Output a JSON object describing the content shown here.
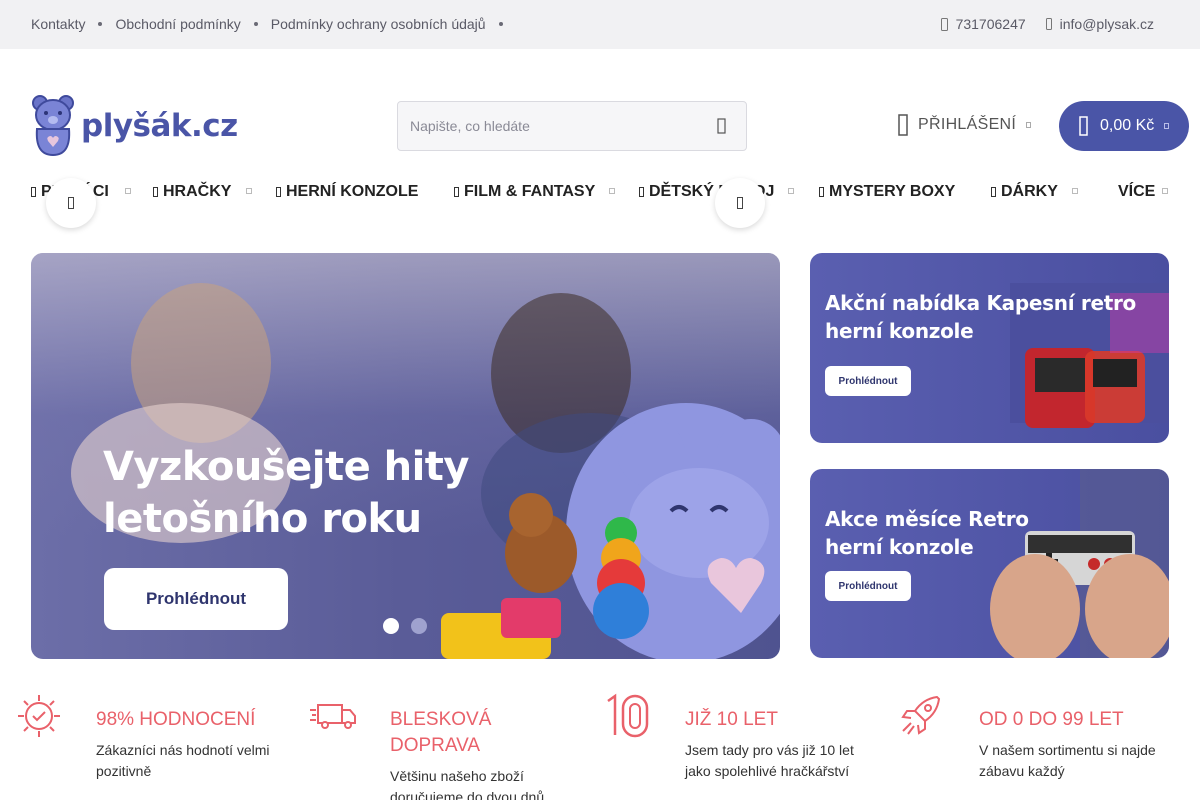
{
  "topbar": {
    "links": [
      "Kontakty",
      "Obchodní podmínky",
      "Podmínky ochrany osobních údajů"
    ],
    "phone": "731706247",
    "email": "info@plysak.cz"
  },
  "header": {
    "logo_text": "plyšák.cz",
    "search_placeholder": "Napište, co hledáte",
    "login_label": "PŘIHLÁŠENÍ",
    "cart_amount": "0,00 Kč"
  },
  "nav": {
    "items": [
      "PLYŠÁCI",
      "HRAČKY",
      "HERNÍ KONZOLE",
      "FILM & FANTASY",
      "DĚTSKÝ POKOJ",
      "MYSTERY BOXY",
      "DÁRKY",
      "VÍCE"
    ]
  },
  "hero": {
    "headline": "Vyzkoušejte hity letošního roku",
    "cta": "Prohlédnout",
    "slides_total": 2,
    "active_slide": 1
  },
  "banners": [
    {
      "title": "Akční nabídka Kapesní retro herní konzole",
      "cta": "Prohlédnout"
    },
    {
      "title": "Akce měsíce Retro herní konzole",
      "cta": "Prohlédnout"
    }
  ],
  "features": [
    {
      "title": "98% HODNOCENÍ",
      "text": "Zákazníci nás hodnotí velmi pozitivně",
      "icon": "rating-badge-icon"
    },
    {
      "title": "BLESKOVÁ DOPRAVA",
      "text": "Většinu našeho zboží doručujeme do dvou dnů",
      "icon": "delivery-truck-icon"
    },
    {
      "title": "JIŽ 10 LET",
      "text": "Jsem tady pro vás již 10 let jako spolehlivé hračkářství",
      "icon": "ten-years-icon"
    },
    {
      "title": "OD 0 DO 99 LET",
      "text": "V našem sortimentu si najde zábavu každý",
      "icon": "rocket-icon"
    }
  ],
  "colors": {
    "brand": "#4a55a7",
    "accent": "#e9616a",
    "topbar_bg": "#f1f1f3"
  }
}
